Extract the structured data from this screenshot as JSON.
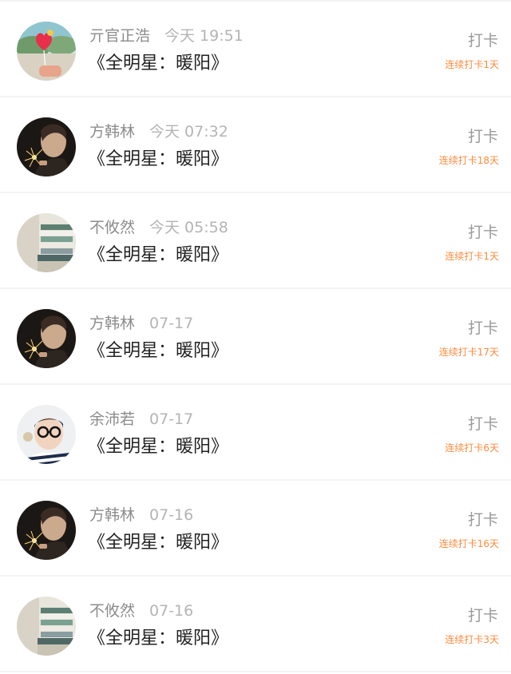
{
  "colors": {
    "accent_orange": "#ff8a3d",
    "name_gray": "#8c8c8c",
    "time_gray": "#b4b4b4",
    "title_dark": "#222222"
  },
  "checkins": [
    {
      "avatar": "balloon-avatar-icon",
      "name": "亓官正浩",
      "time": "今天 19:51",
      "title": "《全明星：暖阳》",
      "action": "打卡",
      "streak": "连续打卡1天"
    },
    {
      "avatar": "sparkler-avatar-icon",
      "name": "方韩林",
      "time": "今天 07:32",
      "title": "《全明星：暖阳》",
      "action": "打卡",
      "streak": "连续打卡18天"
    },
    {
      "avatar": "books-avatar-icon",
      "name": "不攸然",
      "time": "今天 05:58",
      "title": "《全明星：暖阳》",
      "action": "打卡",
      "streak": "连续打卡1天"
    },
    {
      "avatar": "sparkler-avatar-icon",
      "name": "方韩林",
      "time": "07-17",
      "title": "《全明星：暖阳》",
      "action": "打卡",
      "streak": "连续打卡17天"
    },
    {
      "avatar": "glasses-boy-avatar-icon",
      "name": "余沛若",
      "time": "07-17",
      "title": "《全明星：暖阳》",
      "action": "打卡",
      "streak": "连续打卡6天"
    },
    {
      "avatar": "sparkler-avatar-icon",
      "name": "方韩林",
      "time": "07-16",
      "title": "《全明星：暖阳》",
      "action": "打卡",
      "streak": "连续打卡16天"
    },
    {
      "avatar": "books-avatar-icon",
      "name": "不攸然",
      "time": "07-16",
      "title": "《全明星：暖阳》",
      "action": "打卡",
      "streak": "连续打卡3天"
    }
  ]
}
